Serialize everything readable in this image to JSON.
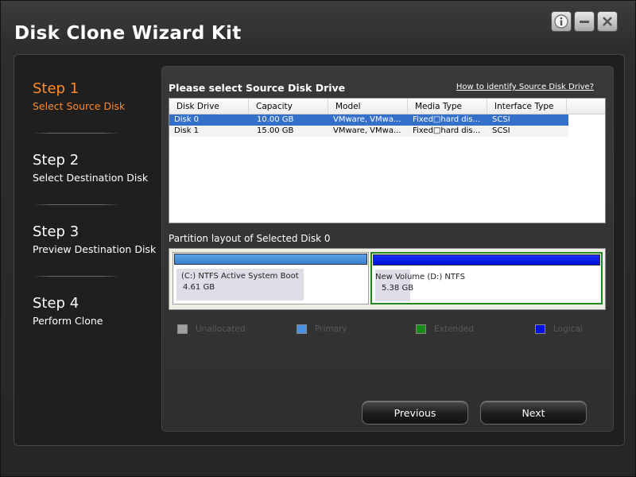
{
  "window": {
    "title": "Disk Clone Wizard Kit"
  },
  "title_buttons": {
    "info_icon": "info-icon",
    "minimize_icon": "minimize-icon",
    "close_icon": "close-icon"
  },
  "steps": [
    {
      "title": "Step 1",
      "subtitle": "Select Source Disk",
      "active": true
    },
    {
      "title": "Step 2",
      "subtitle": "Select Destination Disk",
      "active": false
    },
    {
      "title": "Step 3",
      "subtitle": "Preview Destination Disk",
      "active": false
    },
    {
      "title": "Step 4",
      "subtitle": "Perform Clone",
      "active": false
    }
  ],
  "source": {
    "title": "Please select Source Disk Drive",
    "help_link": "How to identify Source Disk Drive?",
    "columns": [
      "Disk Drive",
      "Capacity",
      "Model",
      "Media Type",
      "Interface Type"
    ],
    "rows": [
      {
        "disk": "Disk 0",
        "capacity": "10.00 GB",
        "model": "VMware, VMwa...",
        "media": "Fixed□hard dis...",
        "interface": "SCSI",
        "selected": true
      },
      {
        "disk": "Disk 1",
        "capacity": "15.00 GB",
        "model": "VMware, VMwa...",
        "media": "Fixed□hard dis...",
        "interface": "SCSI",
        "selected": false
      }
    ]
  },
  "partition": {
    "title": "Partition layout of Selected Disk 0",
    "parts": [
      {
        "label": "(C:)  NTFS  Active  System  Boot",
        "size": "4.61 GB",
        "type": "primary"
      },
      {
        "label": "New Volume  (D:)  NTFS",
        "size": "5.38 GB",
        "type": "logical"
      }
    ]
  },
  "legend": [
    {
      "label": "Unallocated",
      "color": "#a0a0a0"
    },
    {
      "label": "Primary",
      "color": "#4a90e2"
    },
    {
      "label": "Extended",
      "color": "#1a8a1a"
    },
    {
      "label": "Logical",
      "color": "#0010e0"
    }
  ],
  "buttons": {
    "previous": "Previous",
    "next": "Next"
  },
  "colors": {
    "accent": "#ff8a2a",
    "selected_row": "#3470c9"
  }
}
